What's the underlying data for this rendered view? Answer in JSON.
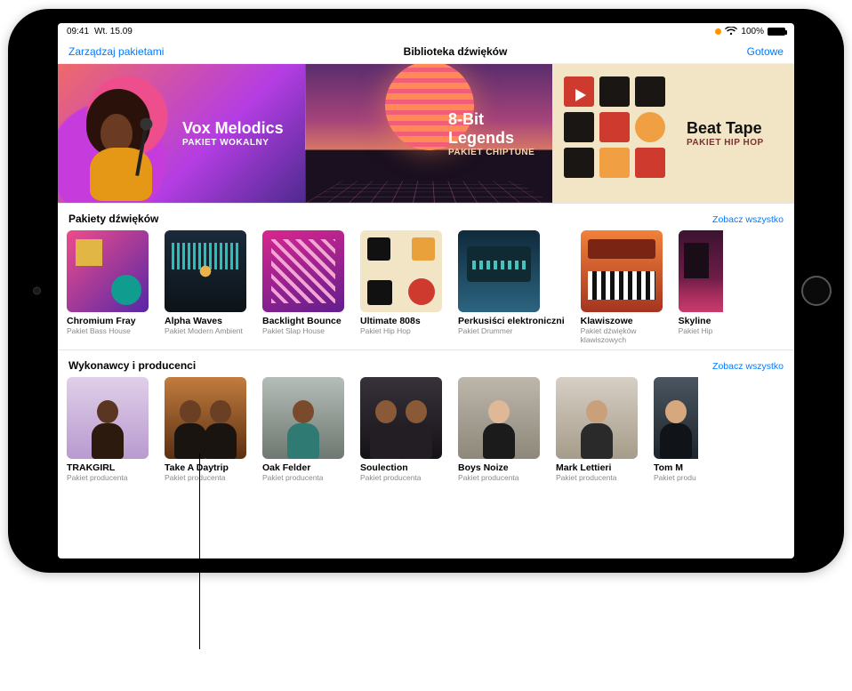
{
  "status": {
    "time": "09:41",
    "date": "Wt. 15.09",
    "battery_pct": "100%"
  },
  "nav": {
    "left": "Zarządzaj pakietami",
    "title": "Biblioteka dźwięków",
    "right": "Gotowe"
  },
  "hero": [
    {
      "title": "Vox Melodics",
      "sub": "PAKIET WOKALNY"
    },
    {
      "title": "8-Bit Legends",
      "sub": "PAKIET CHIPTUNE"
    },
    {
      "title": "Beat Tape",
      "sub": "PAKIET HIP HOP"
    }
  ],
  "packs": {
    "heading": "Pakiety dźwięków",
    "see_all": "Zobacz wszystko",
    "items": [
      {
        "title": "Chromium Fray",
        "sub": "Pakiet Bass House"
      },
      {
        "title": "Alpha Waves",
        "sub": "Pakiet Modern Ambient"
      },
      {
        "title": "Backlight Bounce",
        "sub": "Pakiet Slap House"
      },
      {
        "title": "Ultimate 808s",
        "sub": "Pakiet Hip Hop"
      },
      {
        "title": "Perkusiści elektroniczni",
        "sub": "Pakiet Drummer"
      },
      {
        "title": "Klawiszowe",
        "sub": "Pakiet dźwięków klawiszowych"
      },
      {
        "title": "Skyline",
        "sub": "Pakiet Hip"
      }
    ]
  },
  "artists": {
    "heading": "Wykonawcy i producenci",
    "see_all": "Zobacz wszystko",
    "items": [
      {
        "title": "TRAKGIRL",
        "sub": "Pakiet producenta"
      },
      {
        "title": "Take A Daytrip",
        "sub": "Pakiet producenta"
      },
      {
        "title": "Oak Felder",
        "sub": "Pakiet producenta"
      },
      {
        "title": "Soulection",
        "sub": "Pakiet producenta"
      },
      {
        "title": "Boys Noize",
        "sub": "Pakiet producenta"
      },
      {
        "title": "Mark Lettieri",
        "sub": "Pakiet producenta"
      },
      {
        "title": "Tom M",
        "sub": "Pakiet produ"
      }
    ]
  }
}
